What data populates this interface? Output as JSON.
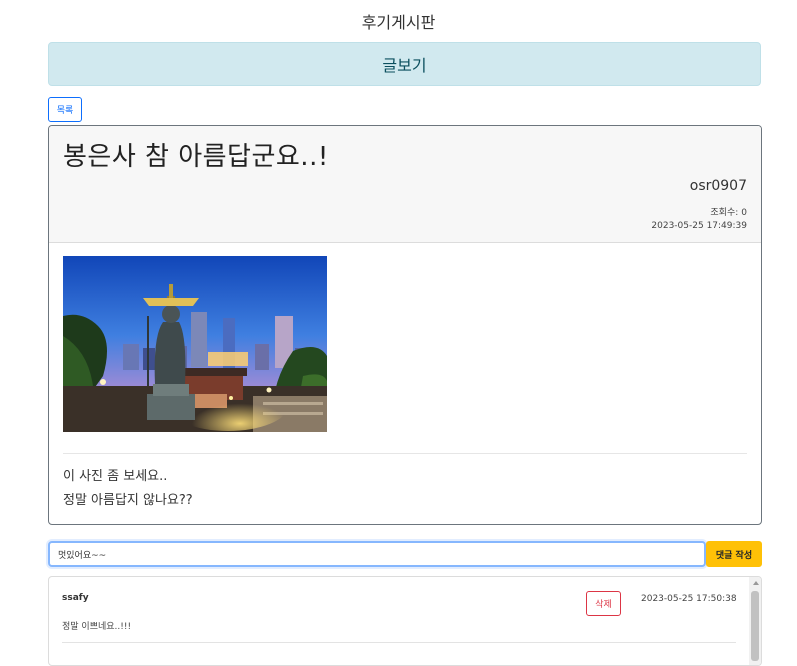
{
  "header": {
    "title": "후기게시판"
  },
  "banner": {
    "label": "글보기"
  },
  "toolbar": {
    "list_label": "목록"
  },
  "post": {
    "title": "봉은사 참 아름답군요..!",
    "author": "osr0907",
    "views_label": "조회수:",
    "views": "0",
    "date": "2023-05-25 17:49:39",
    "body_lines": [
      "이 사진 좀 보세요..",
      "정말 아름답지 않나요??"
    ]
  },
  "comment_form": {
    "value": "멋있어요~~",
    "submit_label": "댓글 작성"
  },
  "comments": [
    {
      "author": "ssafy",
      "content": "정말 이쁘네요..!!!",
      "delete_label": "삭제",
      "date": "2023-05-25 17:50:38"
    }
  ],
  "colors": {
    "banner_bg": "#d1e9ef",
    "primary": "#0d6efd",
    "warning": "#ffc107",
    "danger": "#dc3545"
  }
}
